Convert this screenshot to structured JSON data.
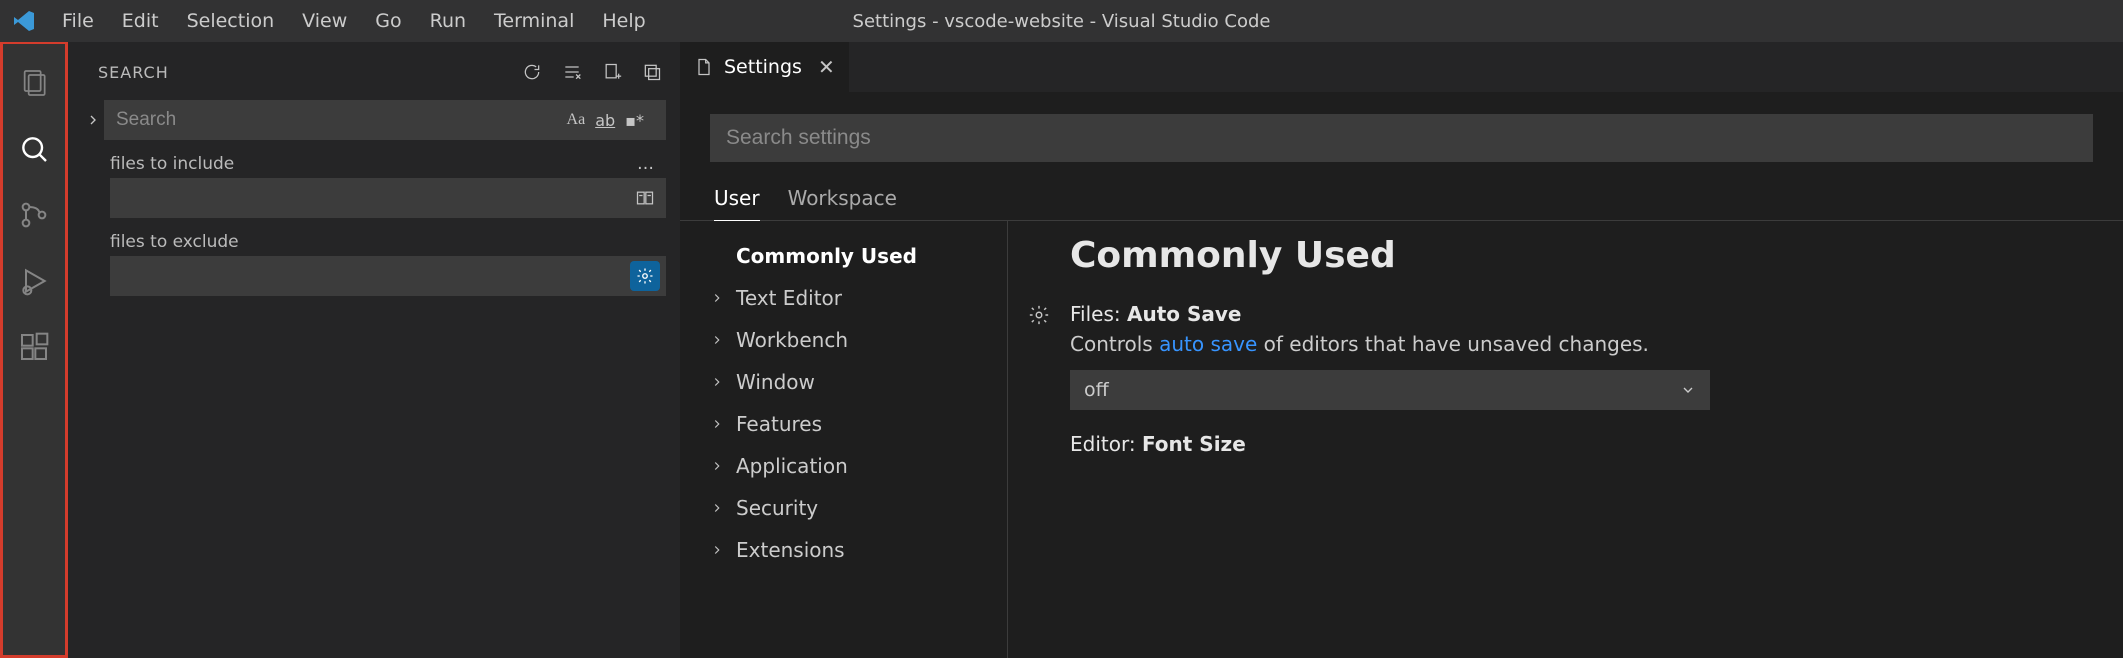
{
  "window_title": "Settings - vscode-website - Visual Studio Code",
  "menu": [
    "File",
    "Edit",
    "Selection",
    "View",
    "Go",
    "Run",
    "Terminal",
    "Help"
  ],
  "activitybar": {
    "items": [
      {
        "name": "explorer"
      },
      {
        "name": "search"
      },
      {
        "name": "source-control"
      },
      {
        "name": "run-debug"
      },
      {
        "name": "extensions"
      }
    ],
    "active": "search"
  },
  "sidebar": {
    "title": "SEARCH",
    "search_placeholder": "Search",
    "search_opts": {
      "case": "Aa",
      "word": "ab",
      "regex": ".*"
    },
    "include_label": "files to include",
    "exclude_label": "files to exclude",
    "include_value": "",
    "exclude_value": ""
  },
  "editor": {
    "tab_label": "Settings",
    "search_placeholder": "Search settings",
    "scope_tabs": [
      "User",
      "Workspace"
    ],
    "scope_active": "User",
    "toc": [
      {
        "label": "Commonly Used",
        "expandable": false,
        "active": true
      },
      {
        "label": "Text Editor",
        "expandable": true
      },
      {
        "label": "Workbench",
        "expandable": true
      },
      {
        "label": "Window",
        "expandable": true
      },
      {
        "label": "Features",
        "expandable": true
      },
      {
        "label": "Application",
        "expandable": true
      },
      {
        "label": "Security",
        "expandable": true
      },
      {
        "label": "Extensions",
        "expandable": true
      }
    ],
    "section_title": "Commonly Used",
    "settings": {
      "autosave": {
        "title_prefix": "Files: ",
        "title_strong": "Auto Save",
        "desc_before": "Controls ",
        "desc_link": "auto save",
        "desc_after": " of editors that have unsaved changes.",
        "value": "off"
      },
      "fontsize": {
        "title_prefix": "Editor: ",
        "title_strong": "Font Size"
      }
    }
  }
}
